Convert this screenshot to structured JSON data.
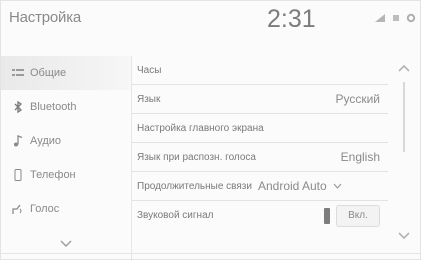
{
  "header": {
    "title": "Настройка",
    "clock": "2:31",
    "status_icons": [
      "signal-icon",
      "dots-icon",
      "gear-icon"
    ]
  },
  "sidebar": {
    "items": [
      {
        "label": "Общие",
        "icon": "settings-list-icon",
        "active": true
      },
      {
        "label": "Bluetooth",
        "icon": "bluetooth-icon",
        "active": false
      },
      {
        "label": "Аудио",
        "icon": "music-note-icon",
        "active": false
      },
      {
        "label": "Телефон",
        "icon": "phone-icon",
        "active": false
      },
      {
        "label": "Голос",
        "icon": "voice-icon",
        "active": false
      }
    ],
    "more_icon": "chevron-down-icon"
  },
  "settings": {
    "rows": [
      {
        "label": "Часы",
        "value": ""
      },
      {
        "label": "Язык",
        "value": "Русский"
      },
      {
        "label": "Настройка главного экрана",
        "value": ""
      },
      {
        "label": "Язык при распозн. голоса",
        "value": "English"
      },
      {
        "label": "Продолжительные связи",
        "value": "Android Auto"
      },
      {
        "label": "Звуковой сигнал",
        "toggle_label": "Вкл."
      }
    ]
  },
  "colors": {
    "background": "#fbfbfb",
    "text": "#7a7a7a",
    "active_item": "#e9e9e9"
  }
}
